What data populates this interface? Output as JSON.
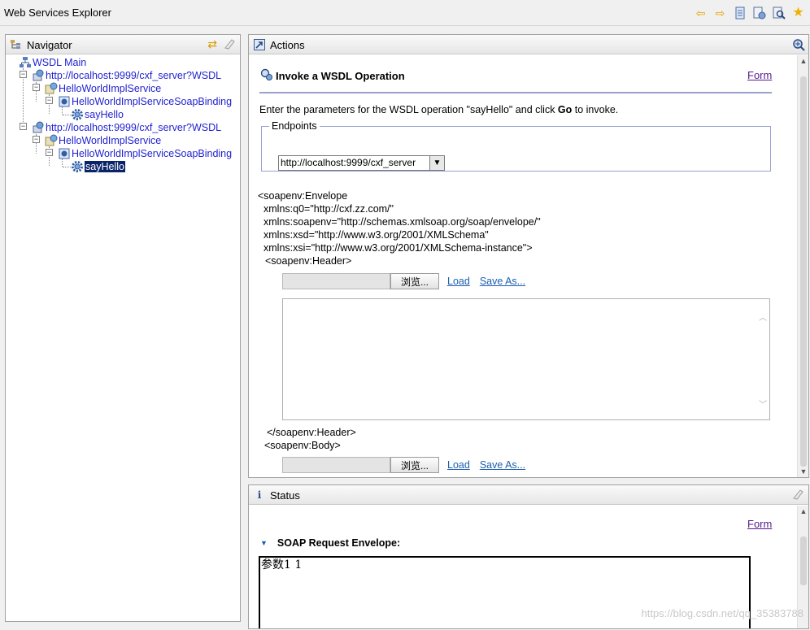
{
  "window": {
    "title": "Web Services Explorer"
  },
  "toolbar": {
    "icons": [
      "back-icon",
      "forward-icon",
      "history-icon",
      "favorites-add-icon",
      "wsdl-search-icon",
      "favorites-icon"
    ]
  },
  "navigator": {
    "title": "Navigator",
    "tree": {
      "root": "WSDL Main",
      "wsdl_1": "http://localhost:9999/cxf_server?WSDL",
      "service_1": "HelloWorldImplService",
      "binding_1": "HelloWorldImplServiceSoapBinding",
      "operation_1": "sayHello",
      "wsdl_2": "http://localhost:9999/cxf_server?WSDL",
      "service_2": "HelloWorldImplService",
      "binding_2": "HelloWorldImplServiceSoapBinding",
      "operation_2": "sayHello"
    }
  },
  "actions": {
    "title": "Actions",
    "heading": "Invoke a WSDL Operation",
    "form_link": "Form",
    "description_before": "Enter the parameters for the WSDL operation \"sayHello\" and click ",
    "description_go": "Go",
    "description_after": " to invoke.",
    "endpoints": {
      "legend": "Endpoints",
      "selected": "http://localhost:9999/cxf_server"
    },
    "xml_envelope_open": "<soapenv:Envelope",
    "xmlns_q0": "xmlns:q0=\"http://cxf.zz.com/\"",
    "xmlns_soapenv": "xmlns:soapenv=\"http://schemas.xmlsoap.org/soap/envelope/\"",
    "xmlns_xsd": "xmlns:xsd=\"http://www.w3.org/2001/XMLSchema\"",
    "xmlns_xsi": "xmlns:xsi=\"http://www.w3.org/2001/XMLSchema-instance\">",
    "header_open": "<soapenv:Header>",
    "header_close": "</soapenv:Header>",
    "body_open": "<soapenv:Body>",
    "browse_label": "浏览...",
    "load_label": "Load",
    "save_as_label": "Save As..."
  },
  "status": {
    "title": "Status",
    "form_link": "Form",
    "soap_request_label": "SOAP Request Envelope:",
    "soap_request_content": "参数1 1"
  },
  "watermark": "https://blog.csdn.net/qq_35383788"
}
